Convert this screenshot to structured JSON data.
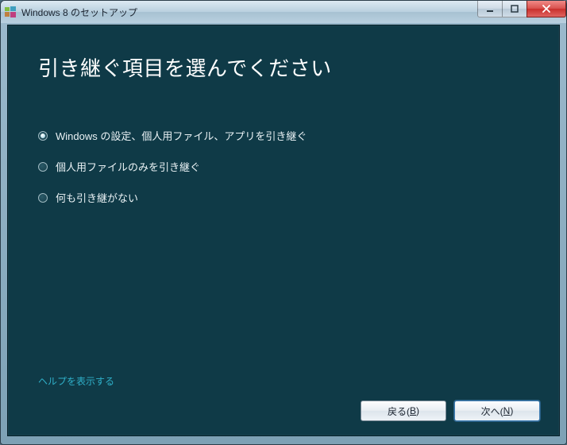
{
  "window": {
    "title": "Windows 8 のセットアップ"
  },
  "page": {
    "heading": "引き継ぐ項目を選んでください"
  },
  "options": [
    {
      "label": "Windows の設定、個人用ファイル、アプリを引き継ぐ",
      "selected": true
    },
    {
      "label": "個人用ファイルのみを引き継ぐ",
      "selected": false
    },
    {
      "label": "何も引き継がない",
      "selected": false
    }
  ],
  "help_link": "ヘルプを表示する",
  "buttons": {
    "back": {
      "prefix": "戻る(",
      "access": "B",
      "suffix": ")"
    },
    "next": {
      "prefix": "次へ(",
      "access": "N",
      "suffix": ")"
    }
  }
}
